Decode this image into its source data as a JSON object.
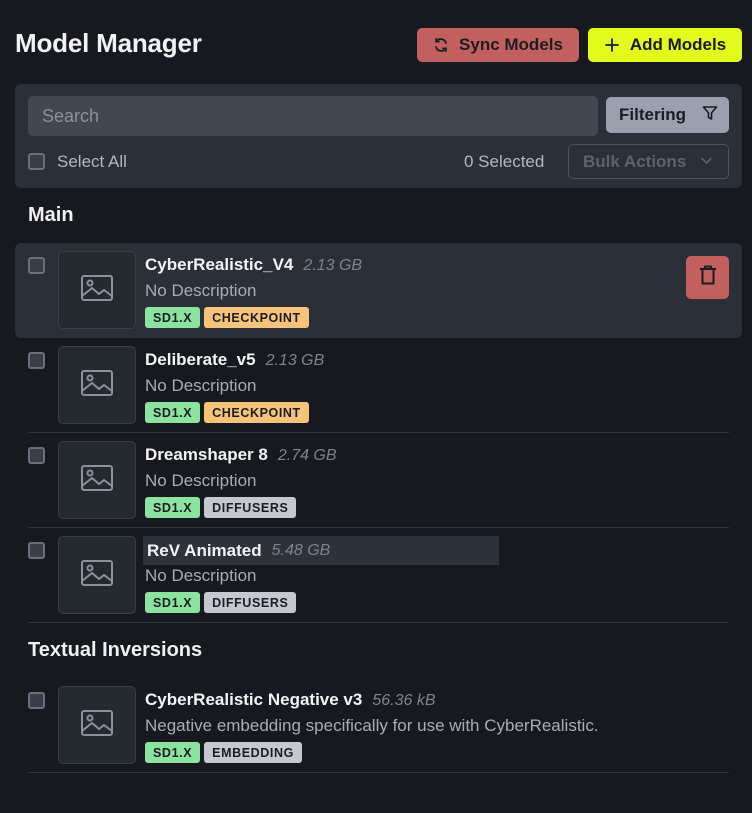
{
  "header": {
    "title": "Model Manager",
    "sync_label": "Sync Models",
    "add_label": "Add Models"
  },
  "toolbar": {
    "search_placeholder": "Search",
    "search_value": "",
    "filtering_label": "Filtering",
    "select_all_label": "Select All",
    "selected_count": "0 Selected",
    "bulk_actions_label": "Bulk Actions"
  },
  "sections": [
    {
      "title": "Main",
      "models": [
        {
          "name": "CyberRealistic_V4",
          "size": "2.13 GB",
          "description": "No Description",
          "base": "SD1.X",
          "format": "CHECKPOINT",
          "selected_row": true
        },
        {
          "name": "Deliberate_v5",
          "size": "2.13 GB",
          "description": "No Description",
          "base": "SD1.X",
          "format": "CHECKPOINT"
        },
        {
          "name": "Dreamshaper 8",
          "size": "2.74 GB",
          "description": "No Description",
          "base": "SD1.X",
          "format": "DIFFUSERS"
        },
        {
          "name": "ReV Animated",
          "size": "5.48 GB",
          "description": "No Description",
          "base": "SD1.X",
          "format": "DIFFUSERS"
        }
      ]
    },
    {
      "title": "Textual Inversions",
      "models": [
        {
          "name": "CyberRealistic Negative v3",
          "size": "56.36 kB",
          "description": "Negative embedding specifically for use with CyberRealistic.",
          "base": "SD1.X",
          "format": "EMBEDDING"
        }
      ]
    }
  ],
  "icons": {
    "sync": "refresh-icon",
    "add": "plus-icon",
    "filter": "filter-icon",
    "bulk": "chevron-down-icon",
    "thumbnail": "image-placeholder-icon",
    "delete": "trash-icon"
  },
  "colors": {
    "background": "#18191e",
    "panel": "#2b2f38",
    "sync_button": "#c26060",
    "add_button": "#e2fa1c",
    "badge_base": "#8ce3a0",
    "badge_checkpoint": "#f6c37a",
    "badge_neutral": "#c4c8d1"
  }
}
